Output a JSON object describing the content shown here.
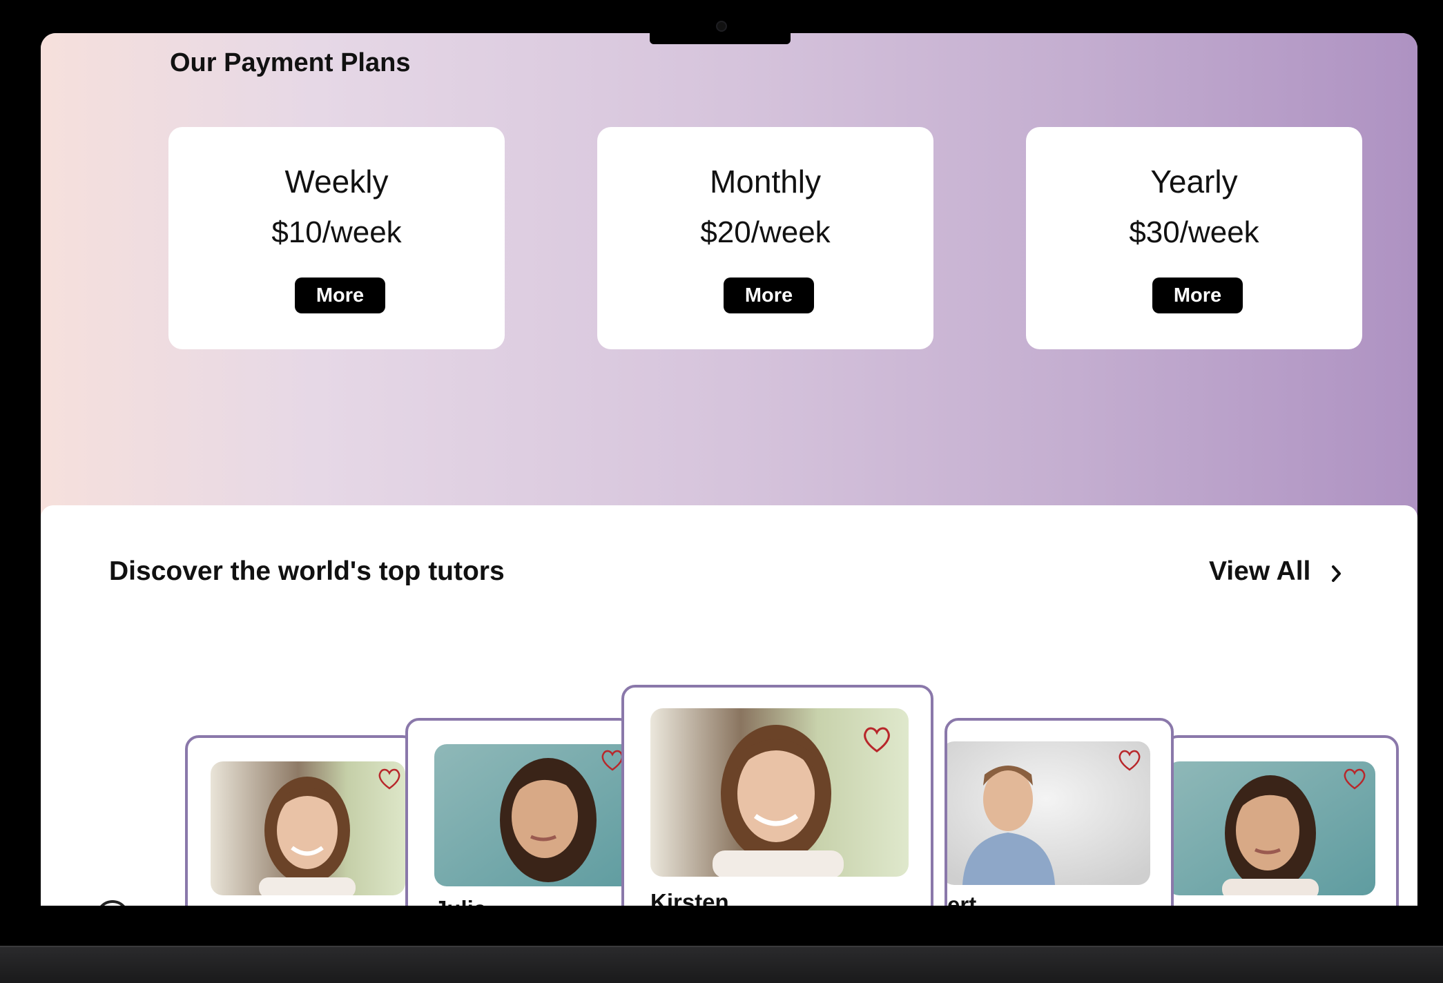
{
  "hero": {
    "title": "Our Payment Plans",
    "plans": [
      {
        "name": "Weekly",
        "price": "$10/week",
        "button": "More"
      },
      {
        "name": "Monthly",
        "price": "$20/week",
        "button": "More"
      },
      {
        "name": "Yearly",
        "price": "$30/week",
        "button": "More"
      }
    ]
  },
  "tutors": {
    "title": "Discover the world's top tutors",
    "view_all": "View All",
    "cards": [
      {
        "name": "",
        "photo": "woman-brown-hair-outdoor"
      },
      {
        "name": "Julia",
        "photo": "woman-dark-hair-teal"
      },
      {
        "name": "Kirsten",
        "photo": "woman-brown-hair-outdoor"
      },
      {
        "name": "ert",
        "photo": "man-blue-shirt-grey"
      },
      {
        "name": "",
        "photo": "woman-dark-hair-teal"
      }
    ]
  },
  "colors": {
    "card_border": "#8a78aa",
    "heart": "#b8272b",
    "button_bg": "#000000"
  }
}
